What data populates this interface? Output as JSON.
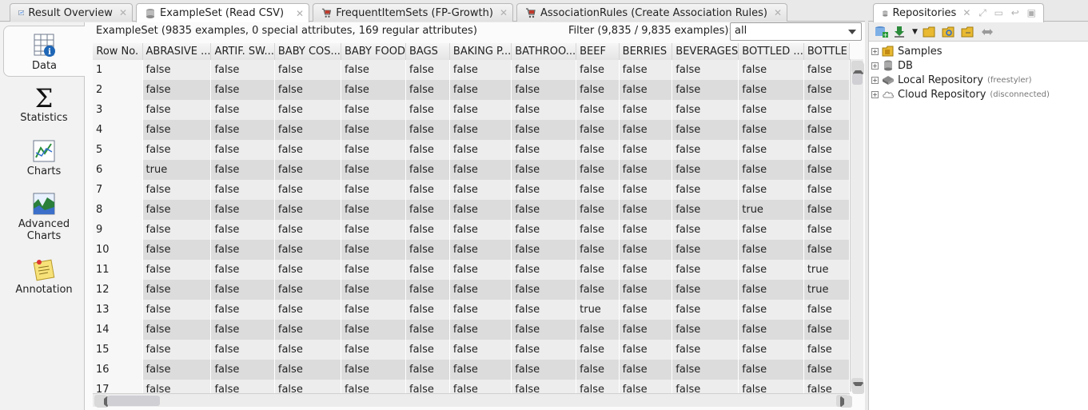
{
  "main_tabs": [
    {
      "label": "Result Overview",
      "icon": "result-overview-icon",
      "active": false
    },
    {
      "label": "ExampleSet (Read CSV)",
      "icon": "database-icon",
      "active": true
    },
    {
      "label": "FrequentItemSets (FP-Growth)",
      "icon": "cart-icon",
      "active": false
    },
    {
      "label": "AssociationRules (Create Association Rules)",
      "icon": "cart-icon",
      "active": false
    }
  ],
  "repo_tab": {
    "label": "Repositories",
    "icon": "database-icon"
  },
  "views": [
    {
      "label": "Data",
      "icon": "data-table-icon",
      "active": true
    },
    {
      "label": "Statistics",
      "icon": "sigma-icon",
      "active": false
    },
    {
      "label": "Charts",
      "icon": "chart-icon",
      "active": false
    },
    {
      "label": "Advanced\nCharts",
      "icon": "advanced-chart-icon",
      "active": false
    },
    {
      "label": "Annotation",
      "icon": "annotation-icon",
      "active": false
    }
  ],
  "info": "ExampleSet (9835 examples, 0 special attributes, 169 regular attributes)",
  "filter": {
    "label": "Filter (9,835 / 9,835 examples):",
    "value": "all"
  },
  "table": {
    "columns": [
      "Row No.",
      "ABRASIVE ...",
      "ARTIF. SW...",
      "BABY COS...",
      "BABY FOOD",
      "BAGS",
      "BAKING P...",
      "BATHROO...",
      "BEEF",
      "BERRIES",
      "BEVERAGES",
      "BOTTLED ...",
      "BOTTLE"
    ],
    "rows": [
      [
        "1",
        "false",
        "false",
        "false",
        "false",
        "false",
        "false",
        "false",
        "false",
        "false",
        "false",
        "false",
        "false"
      ],
      [
        "2",
        "false",
        "false",
        "false",
        "false",
        "false",
        "false",
        "false",
        "false",
        "false",
        "false",
        "false",
        "false"
      ],
      [
        "3",
        "false",
        "false",
        "false",
        "false",
        "false",
        "false",
        "false",
        "false",
        "false",
        "false",
        "false",
        "false"
      ],
      [
        "4",
        "false",
        "false",
        "false",
        "false",
        "false",
        "false",
        "false",
        "false",
        "false",
        "false",
        "false",
        "false"
      ],
      [
        "5",
        "false",
        "false",
        "false",
        "false",
        "false",
        "false",
        "false",
        "false",
        "false",
        "false",
        "false",
        "false"
      ],
      [
        "6",
        "true",
        "false",
        "false",
        "false",
        "false",
        "false",
        "false",
        "false",
        "false",
        "false",
        "false",
        "false"
      ],
      [
        "7",
        "false",
        "false",
        "false",
        "false",
        "false",
        "false",
        "false",
        "false",
        "false",
        "false",
        "false",
        "false"
      ],
      [
        "8",
        "false",
        "false",
        "false",
        "false",
        "false",
        "false",
        "false",
        "false",
        "false",
        "false",
        "true",
        "false"
      ],
      [
        "9",
        "false",
        "false",
        "false",
        "false",
        "false",
        "false",
        "false",
        "false",
        "false",
        "false",
        "false",
        "false"
      ],
      [
        "10",
        "false",
        "false",
        "false",
        "false",
        "false",
        "false",
        "false",
        "false",
        "false",
        "false",
        "false",
        "false"
      ],
      [
        "11",
        "false",
        "false",
        "false",
        "false",
        "false",
        "false",
        "false",
        "false",
        "false",
        "false",
        "false",
        "true"
      ],
      [
        "12",
        "false",
        "false",
        "false",
        "false",
        "false",
        "false",
        "false",
        "false",
        "false",
        "false",
        "false",
        "true"
      ],
      [
        "13",
        "false",
        "false",
        "false",
        "false",
        "false",
        "false",
        "false",
        "true",
        "false",
        "false",
        "false",
        "false"
      ],
      [
        "14",
        "false",
        "false",
        "false",
        "false",
        "false",
        "false",
        "false",
        "false",
        "false",
        "false",
        "false",
        "false"
      ],
      [
        "15",
        "false",
        "false",
        "false",
        "false",
        "false",
        "false",
        "false",
        "false",
        "false",
        "false",
        "false",
        "false"
      ],
      [
        "16",
        "false",
        "false",
        "false",
        "false",
        "false",
        "false",
        "false",
        "false",
        "false",
        "false",
        "false",
        "false"
      ],
      [
        "17",
        "false",
        "false",
        "false",
        "false",
        "false",
        "false",
        "false",
        "false",
        "false",
        "false",
        "false",
        "false"
      ]
    ]
  },
  "repo_tree": [
    {
      "label": "Samples",
      "note": "",
      "icon": "samples-folder-icon"
    },
    {
      "label": "DB",
      "note": "",
      "icon": "db-icon"
    },
    {
      "label": "Local Repository",
      "note": "(freestyler)",
      "icon": "local-repo-icon"
    },
    {
      "label": "Cloud Repository",
      "note": "(disconnected)",
      "icon": "cloud-icon"
    }
  ]
}
